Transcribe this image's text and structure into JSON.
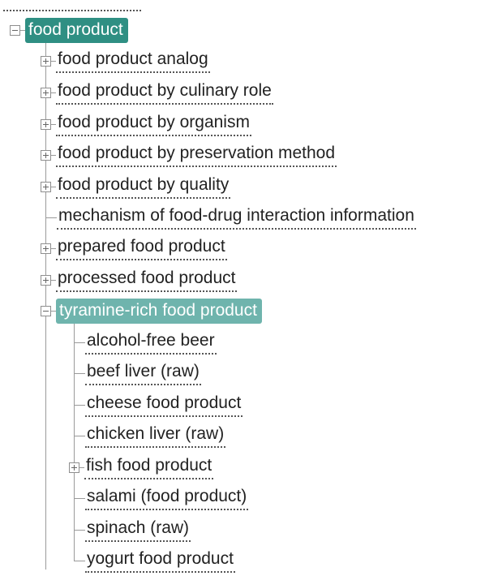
{
  "tree": {
    "root": {
      "label": "food product",
      "state": "expanded"
    },
    "children": [
      {
        "label": "food product analog",
        "state": "collapsed"
      },
      {
        "label": "food product by culinary role",
        "state": "collapsed"
      },
      {
        "label": "food product by organism",
        "state": "collapsed"
      },
      {
        "label": "food product by preservation method",
        "state": "collapsed"
      },
      {
        "label": "food product by quality",
        "state": "collapsed"
      },
      {
        "label": "mechanism of food-drug interaction information",
        "state": "leaf"
      },
      {
        "label": "prepared food product",
        "state": "collapsed"
      },
      {
        "label": "processed food product",
        "state": "collapsed"
      },
      {
        "label": "tyramine-rich food product",
        "state": "expanded"
      }
    ],
    "grandchildren": [
      {
        "label": "alcohol-free beer",
        "state": "leaf"
      },
      {
        "label": "beef liver (raw)",
        "state": "leaf"
      },
      {
        "label": "cheese food product",
        "state": "leaf"
      },
      {
        "label": "chicken liver (raw)",
        "state": "leaf"
      },
      {
        "label": "fish food product",
        "state": "collapsed"
      },
      {
        "label": "salami (food product)",
        "state": "leaf"
      },
      {
        "label": "spinach (raw)",
        "state": "leaf"
      },
      {
        "label": "yogurt food product",
        "state": "leaf"
      }
    ]
  },
  "colors": {
    "selected_bg": "#2f8f83",
    "selected_secondary_bg": "#6fb4ad",
    "tree_line": "#9a9a9a"
  }
}
